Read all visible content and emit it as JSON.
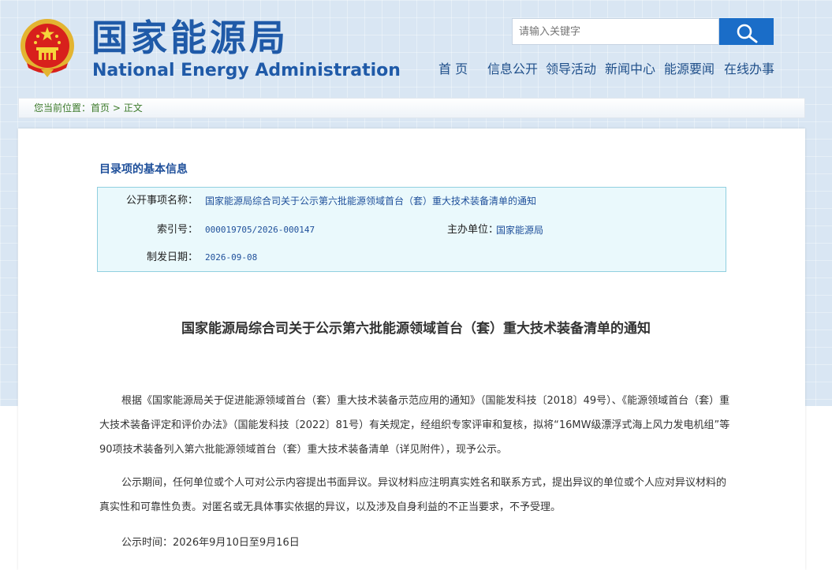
{
  "header": {
    "logo_cn": "国家能源局",
    "logo_en": "National Energy Administration"
  },
  "search": {
    "placeholder": "请输入关键字"
  },
  "nav": {
    "items": [
      "首 页",
      "信息公开",
      "领导活动",
      "新闻中心",
      "能源要闻",
      "在线办事"
    ]
  },
  "breadcrumb": {
    "prefix": "您当前位置：",
    "home": "首页",
    "separator": ">",
    "current": "正文"
  },
  "basic_info": {
    "section_title": "目录项的基本信息",
    "name_label": "公开事项名称：",
    "name_value": "国家能源局综合司关于公示第六批能源领域首台（套）重大技术装备清单的通知",
    "index_label": "索引号：",
    "index_value": "000019705/2026-000147",
    "issuer_label": "主办单位：",
    "issuer_value": "国家能源局",
    "date_label": "制发日期：",
    "date_value": "2026-09-08"
  },
  "article": {
    "title": "国家能源局综合司关于公示第六批能源领域首台（套）重大技术装备清单的通知",
    "paragraphs": [
      "根据《国家能源局关于促进能源领域首台（套）重大技术装备示范应用的通知》（国能发科技〔2018〕49号）、《能源领域首台（套）重大技术装备评定和评价办法》（国能发科技〔2022〕81号）有关规定，经组织专家评审和复核，拟将“16MW级漂浮式海上风力发电机组”等90项技术装备列入第六批能源领域首台（套）重大技术装备清单（详见附件），现予公示。",
      "公示期间，任何单位或个人可对公示内容提出书面异议。异议材料应注明真实姓名和联系方式，提出异议的单位或个人应对异议材料的真实性和可靠性负责。对匿名或无具体事实依据的异议，以及涉及自身利益的不正当要求，不予受理。",
      "公示时间：2026年9月10日至9月16日"
    ]
  },
  "colors": {
    "brand_blue": "#1f5aa8",
    "search_button": "#1a6dc8",
    "info_border": "#90cfe0",
    "info_bg": "#eaf9fc",
    "breadcrumb_green": "#3c7a2a"
  }
}
